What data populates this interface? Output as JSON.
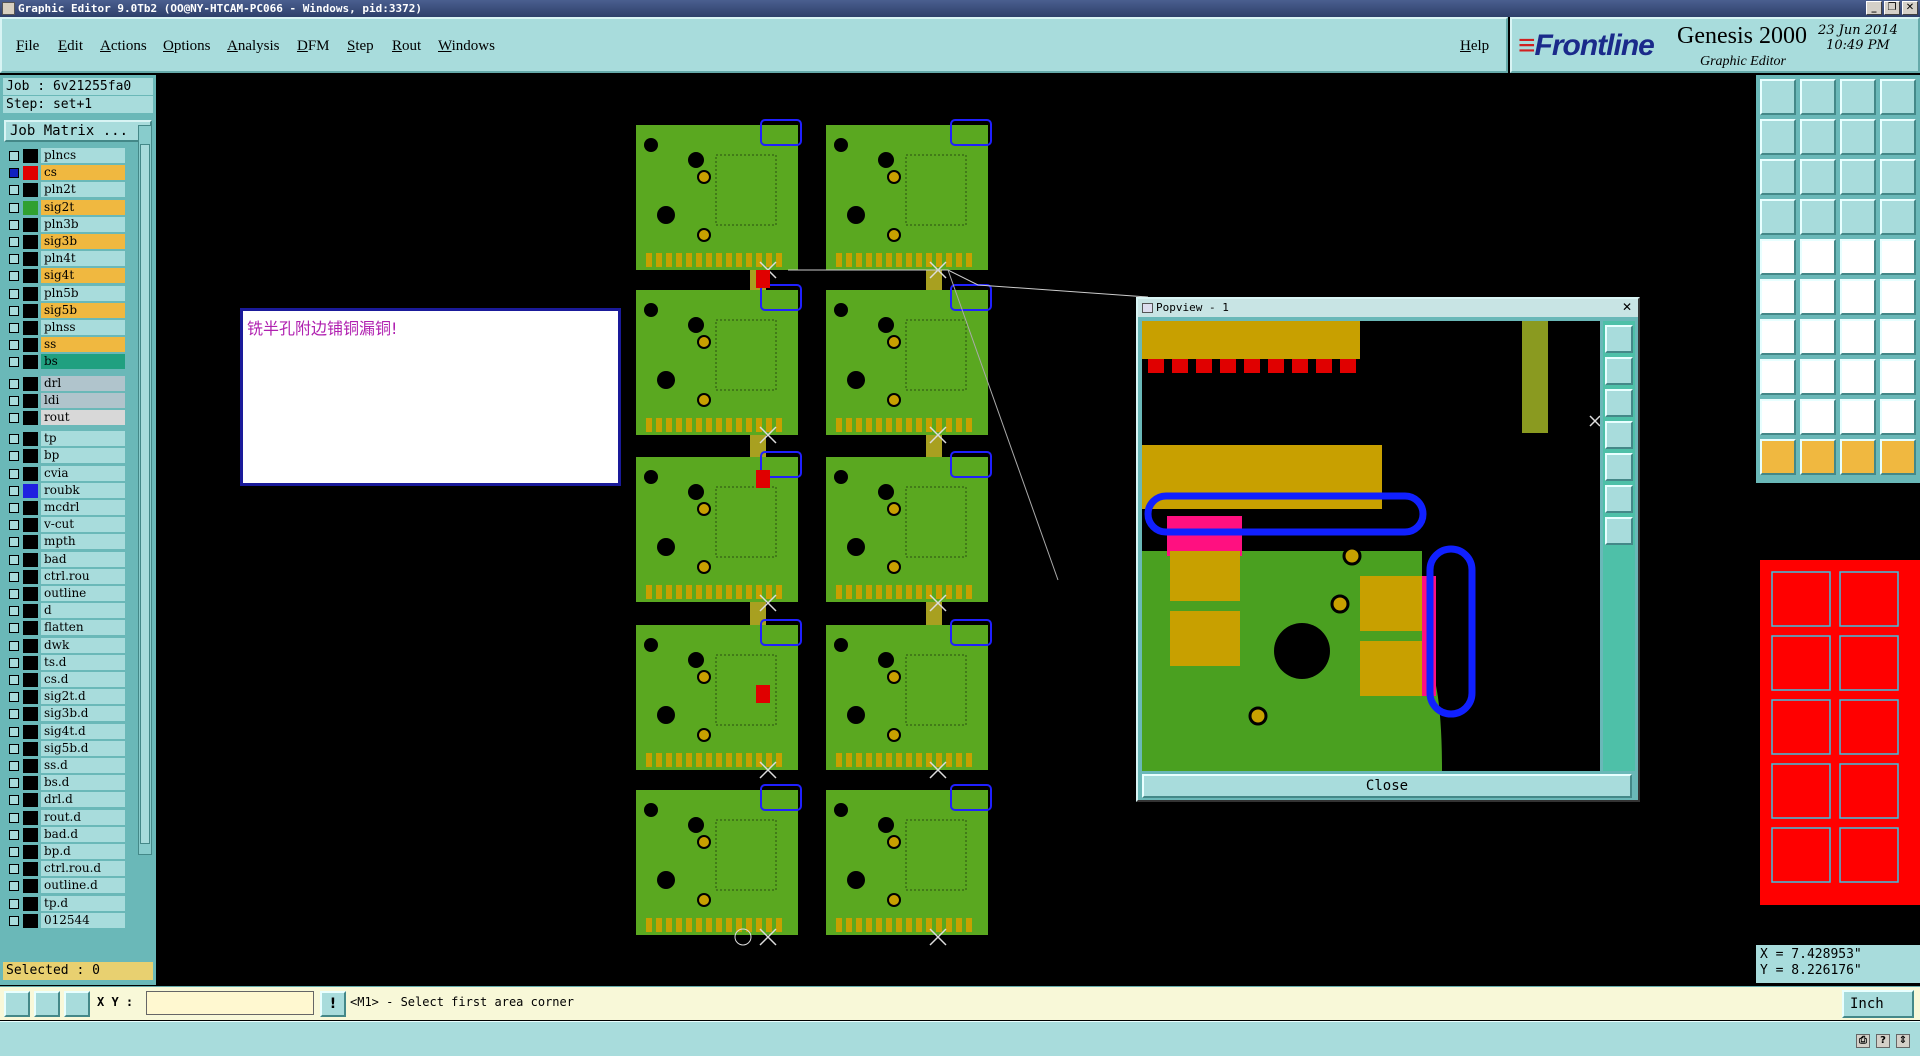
{
  "titlebar": {
    "title": "Graphic Editor 9.0Tb2 (OO@NY-HTCAM-PC066 - Windows, pid:3372)",
    "buttons": [
      "_",
      "❐",
      "✕"
    ]
  },
  "menu": {
    "items": [
      "File",
      "Edit",
      "Actions",
      "Options",
      "Analysis",
      "DFM",
      "Step",
      "Rout",
      "Windows"
    ],
    "help": "Help"
  },
  "brand": {
    "logo": "Frontline",
    "product": "Genesis 2000",
    "subtitle": "Graphic Editor",
    "date": "23 Jun 2014",
    "time": "10:49 PM"
  },
  "job": {
    "job_label": "Job : 6v21255fa0",
    "step_label": "Step: set+1",
    "matrix_button": "Job Matrix ..."
  },
  "layers": [
    {
      "name": "plncs",
      "bg": "#a8dcdc",
      "swatch": ""
    },
    {
      "name": "cs",
      "bg": "#f0b840",
      "swatch": "#e00000",
      "active": true
    },
    {
      "name": "pln2t",
      "bg": "#a8dcdc",
      "swatch": ""
    },
    {
      "name": "sig2t",
      "bg": "#f0b840",
      "swatch": "#30a030"
    },
    {
      "name": "pln3b",
      "bg": "#a8dcdc",
      "swatch": ""
    },
    {
      "name": "sig3b",
      "bg": "#f0b840",
      "swatch": ""
    },
    {
      "name": "pln4t",
      "bg": "#a8dcdc",
      "swatch": ""
    },
    {
      "name": "sig4t",
      "bg": "#f0b840",
      "swatch": ""
    },
    {
      "name": "pln5b",
      "bg": "#a8dcdc",
      "swatch": ""
    },
    {
      "name": "sig5b",
      "bg": "#f0b840",
      "swatch": ""
    },
    {
      "name": "plnss",
      "bg": "#a8dcdc",
      "swatch": ""
    },
    {
      "name": "ss",
      "bg": "#f0b840",
      "swatch": ""
    },
    {
      "name": "bs",
      "bg": "#20a080",
      "swatch": ""
    },
    {
      "name": "drl",
      "bg": "#b0c4cc",
      "swatch": ""
    },
    {
      "name": "ldi",
      "bg": "#b0c4cc",
      "swatch": ""
    },
    {
      "name": "rout",
      "bg": "#d8d8d8",
      "swatch": ""
    },
    {
      "name": "tp",
      "bg": "#a8dcdc",
      "swatch": ""
    },
    {
      "name": "bp",
      "bg": "#a8dcdc",
      "swatch": ""
    },
    {
      "name": "cvia",
      "bg": "#a8dcdc",
      "swatch": ""
    },
    {
      "name": "roubk",
      "bg": "#a8dcdc",
      "swatch": "#2020e0"
    },
    {
      "name": "mcdrl",
      "bg": "#a8dcdc",
      "swatch": ""
    },
    {
      "name": "v-cut",
      "bg": "#a8dcdc",
      "swatch": ""
    },
    {
      "name": "mpth",
      "bg": "#a8dcdc",
      "swatch": ""
    },
    {
      "name": "bad",
      "bg": "#a8dcdc",
      "swatch": ""
    },
    {
      "name": "ctrl.rou",
      "bg": "#a8dcdc",
      "swatch": ""
    },
    {
      "name": "outline",
      "bg": "#a8dcdc",
      "swatch": ""
    },
    {
      "name": "d",
      "bg": "#a8dcdc",
      "swatch": ""
    },
    {
      "name": "flatten",
      "bg": "#a8dcdc",
      "swatch": ""
    },
    {
      "name": "dwk",
      "bg": "#a8dcdc",
      "swatch": ""
    },
    {
      "name": "ts.d",
      "bg": "#a8dcdc",
      "swatch": ""
    },
    {
      "name": "cs.d",
      "bg": "#a8dcdc",
      "swatch": ""
    },
    {
      "name": "sig2t.d",
      "bg": "#a8dcdc",
      "swatch": ""
    },
    {
      "name": "sig3b.d",
      "bg": "#a8dcdc",
      "swatch": ""
    },
    {
      "name": "sig4t.d",
      "bg": "#a8dcdc",
      "swatch": ""
    },
    {
      "name": "sig5b.d",
      "bg": "#a8dcdc",
      "swatch": ""
    },
    {
      "name": "ss.d",
      "bg": "#a8dcdc",
      "swatch": ""
    },
    {
      "name": "bs.d",
      "bg": "#a8dcdc",
      "swatch": ""
    },
    {
      "name": "drl.d",
      "bg": "#a8dcdc",
      "swatch": ""
    },
    {
      "name": "rout.d",
      "bg": "#a8dcdc",
      "swatch": ""
    },
    {
      "name": "bad.d",
      "bg": "#a8dcdc",
      "swatch": ""
    },
    {
      "name": "bp.d",
      "bg": "#a8dcdc",
      "swatch": ""
    },
    {
      "name": "ctrl.rou.d",
      "bg": "#a8dcdc",
      "swatch": ""
    },
    {
      "name": "outline.d",
      "bg": "#a8dcdc",
      "swatch": ""
    },
    {
      "name": "tp.d",
      "bg": "#a8dcdc",
      "swatch": ""
    },
    {
      "name": "012544",
      "bg": "#a8dcdc",
      "swatch": ""
    }
  ],
  "selected": "Selected : 0",
  "note": "铣半孔附边铺铜漏铜!",
  "popview": {
    "title": "Popview - 1",
    "close_label": "Close"
  },
  "coords": {
    "x": "X = 7.428953\"",
    "y": "Y = 8.226176\""
  },
  "status": {
    "xy_label": "X Y :",
    "xy_value": "",
    "prompt": "<M1> - Select first area corner",
    "unit": "Inch"
  },
  "colors": {
    "panel": "#a8dcdc",
    "board": "#5aa820",
    "copper": "#c8a000",
    "highlight": "#ff0080",
    "rout": "#1020ff"
  }
}
